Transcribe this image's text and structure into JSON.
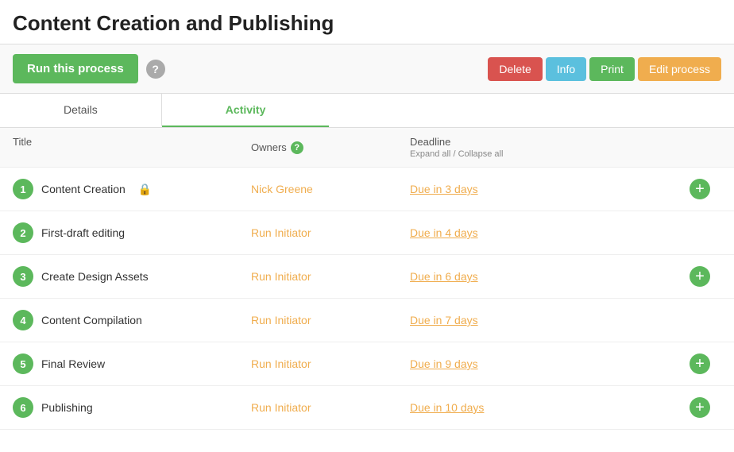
{
  "page": {
    "title": "Content Creation and Publishing"
  },
  "toolbar": {
    "run_label": "Run this process",
    "help_icon": "?",
    "delete_label": "Delete",
    "info_label": "Info",
    "print_label": "Print",
    "edit_label": "Edit process"
  },
  "tabs": [
    {
      "id": "details",
      "label": "Details",
      "active": false
    },
    {
      "id": "activity",
      "label": "Activity",
      "active": true
    }
  ],
  "table": {
    "col_title": "Title",
    "col_owners": "Owners",
    "col_deadline": "Deadline",
    "expand_all": "Expand all",
    "collapse_all": "Collapse all"
  },
  "tasks": [
    {
      "step": "1",
      "name": "Content Creation",
      "has_lock": true,
      "owner": "Nick Greene",
      "deadline": "Due in 3 days",
      "has_add": true
    },
    {
      "step": "2",
      "name": "First-draft editing",
      "has_lock": false,
      "owner": "Run Initiator",
      "deadline": "Due in 4 days",
      "has_add": false
    },
    {
      "step": "3",
      "name": "Create Design Assets",
      "has_lock": false,
      "owner": "Run Initiator",
      "deadline": "Due in 6 days",
      "has_add": true
    },
    {
      "step": "4",
      "name": "Content Compilation",
      "has_lock": false,
      "owner": "Run Initiator",
      "deadline": "Due in 7 days",
      "has_add": false
    },
    {
      "step": "5",
      "name": "Final Review",
      "has_lock": false,
      "owner": "Run Initiator",
      "deadline": "Due in 9 days",
      "has_add": true
    },
    {
      "step": "6",
      "name": "Publishing",
      "has_lock": false,
      "owner": "Run Initiator",
      "deadline": "Due in 10 days",
      "has_add": true
    }
  ]
}
